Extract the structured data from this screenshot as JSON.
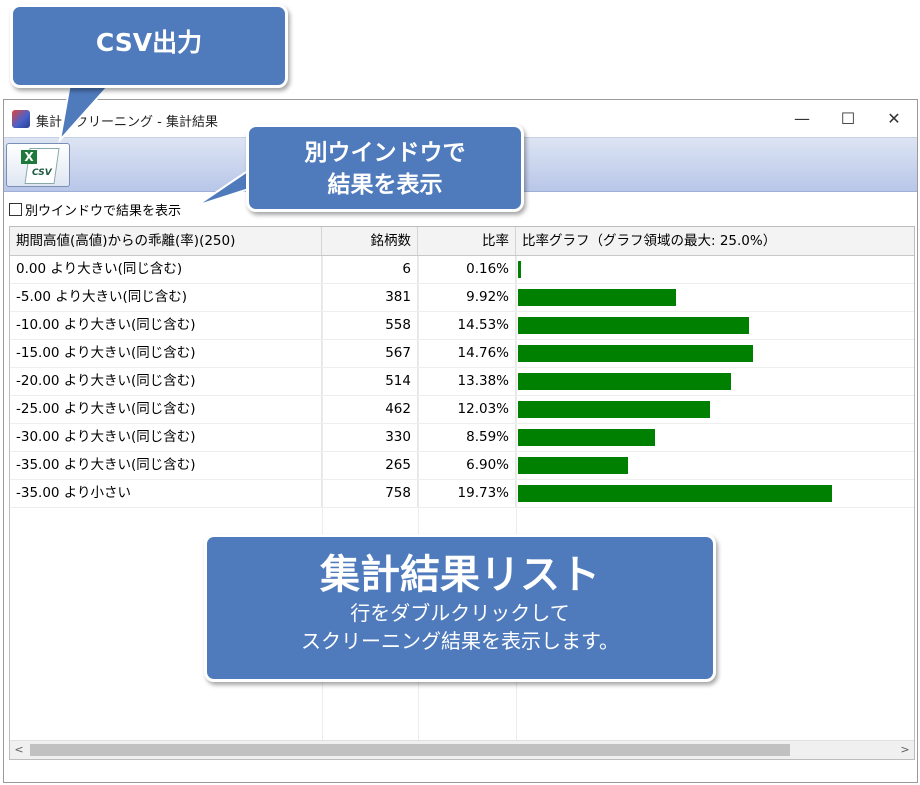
{
  "window": {
    "title": "集計スクリーニング - 集計結果",
    "controls": {
      "minimize": "—",
      "maximize": "☐",
      "close": "✕"
    }
  },
  "toolbar": {
    "csv_button": {
      "icon": "excel-csv-icon",
      "text": "CSV",
      "x_mark": "X"
    }
  },
  "option": {
    "separate_window_label": "別ウインドウで結果を表示",
    "checked": false
  },
  "grid": {
    "columns": [
      "期間高値(高値)からの乖離(率)(250)",
      "銘柄数",
      "比率",
      "比率グラフ（グラフ領域の最大: 25.0%）"
    ],
    "graph_max_percent": 25.0,
    "bar_color": "#008000",
    "rows": [
      {
        "label": "0.00 より大きい(同じ含む)",
        "count": "6",
        "ratio": "0.16%",
        "ratio_value": 0.16
      },
      {
        "label": "-5.00 より大きい(同じ含む)",
        "count": "381",
        "ratio": "9.92%",
        "ratio_value": 9.92
      },
      {
        "label": "-10.00 より大きい(同じ含む)",
        "count": "558",
        "ratio": "14.53%",
        "ratio_value": 14.53
      },
      {
        "label": "-15.00 より大きい(同じ含む)",
        "count": "567",
        "ratio": "14.76%",
        "ratio_value": 14.76
      },
      {
        "label": "-20.00 より大きい(同じ含む)",
        "count": "514",
        "ratio": "13.38%",
        "ratio_value": 13.38
      },
      {
        "label": "-25.00 より大きい(同じ含む)",
        "count": "462",
        "ratio": "12.03%",
        "ratio_value": 12.03
      },
      {
        "label": "-30.00 より大きい(同じ含む)",
        "count": "330",
        "ratio": "8.59%",
        "ratio_value": 8.59
      },
      {
        "label": "-35.00 より大きい(同じ含む)",
        "count": "265",
        "ratio": "6.90%",
        "ratio_value": 6.9
      },
      {
        "label": "-35.00 より小さい",
        "count": "758",
        "ratio": "19.73%",
        "ratio_value": 19.73
      }
    ]
  },
  "scrollbar": {
    "left_arrow": "<",
    "right_arrow": ">"
  },
  "callouts": {
    "csv": "CSV出力",
    "window_line1": "別ウインドウで",
    "window_line2": "結果を表示",
    "list_title": "集計結果リスト",
    "list_line1": "行をダブルクリックして",
    "list_line2": "スクリーニング結果を表示します。",
    "color": "#4f7bbd"
  }
}
